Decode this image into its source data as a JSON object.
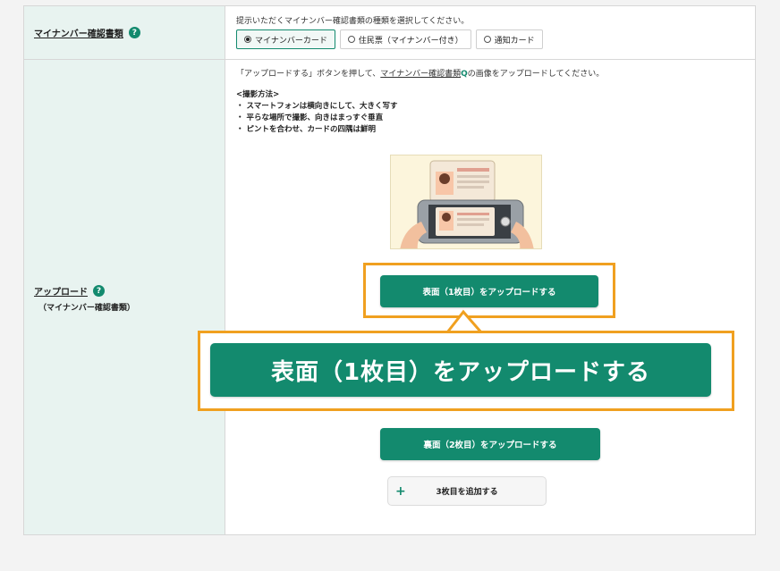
{
  "form": {
    "row1": {
      "label": "マイナンバー確認書類",
      "help": "?",
      "instruction": "提示いただくマイナンバー確認書類の種類を選択してください。",
      "options": [
        {
          "label": "マイナンバーカード",
          "selected": true
        },
        {
          "label": "住民票（マイナンバー付き）",
          "selected": false
        },
        {
          "label": "通知カード",
          "selected": false
        }
      ]
    },
    "row2": {
      "label": "アップロード",
      "help": "?",
      "sublabel": "（マイナンバー確認書類）",
      "note_prefix": "「アップロードする」ボタンを押して、",
      "note_link": "マイナンバー確認書類",
      "note_icon": "Q",
      "note_suffix": "の画像をアップロードしてください。",
      "tips_title": "<撮影方法>",
      "tips": [
        "・ スマートフォンは横向きにして、大きく写す",
        "・ 平らな場所で撮影、向きはまっすぐ垂直",
        "・ ピントを合わせ、カードの四隅は鮮明"
      ],
      "front_button": "表面（1枚目）をアップロードする",
      "back_button": "裏面（2枚目）をアップロードする",
      "add_button": "3枚目を追加する",
      "add_icon": "+"
    }
  },
  "callout": {
    "text": "表面（1枚目）をアップロードする"
  },
  "colors": {
    "accent": "#138a6e",
    "highlight": "#f0a020",
    "label_bg": "#e8f3f0"
  }
}
